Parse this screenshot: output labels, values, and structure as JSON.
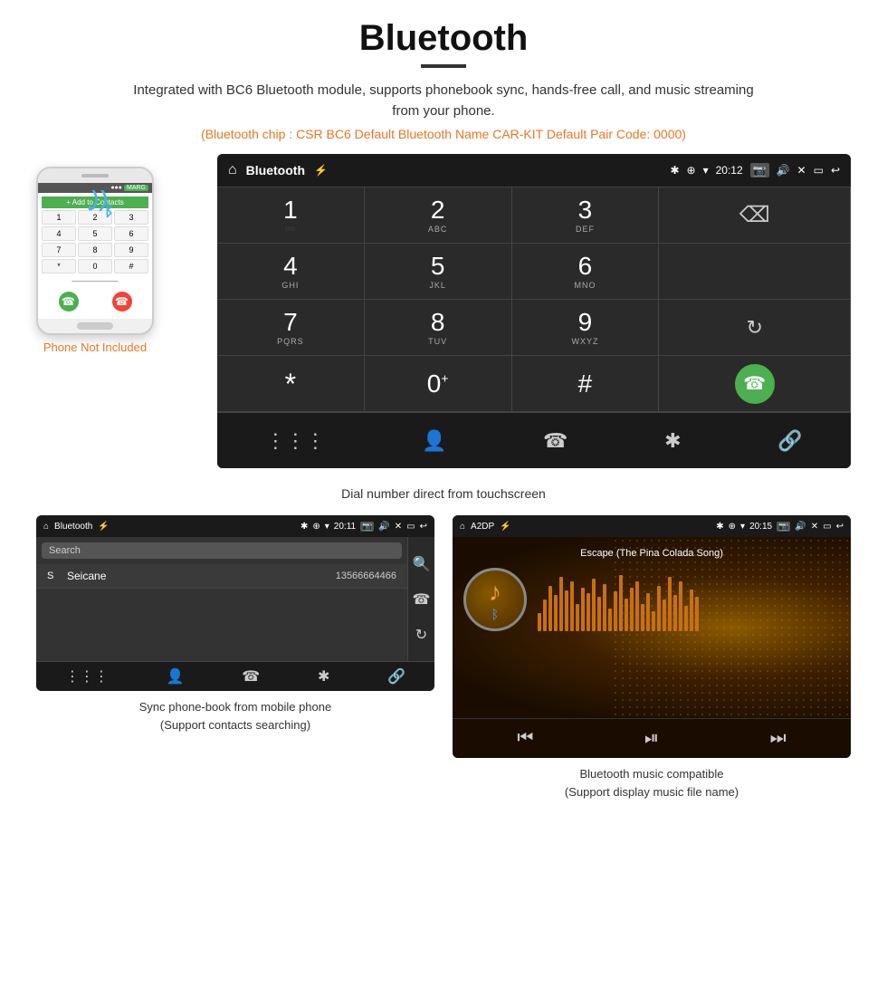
{
  "page": {
    "title": "Bluetooth",
    "subtitle": "Integrated with BC6 Bluetooth module, supports phonebook sync, hands-free call, and music streaming from your phone.",
    "orange_info": "(Bluetooth chip : CSR BC6    Default Bluetooth Name CAR-KIT    Default Pair Code: 0000)",
    "dial_caption": "Dial number direct from touchscreen",
    "phonebook_caption": "Sync phone-book from mobile phone\n(Support contacts searching)",
    "music_caption": "Bluetooth music compatible\n(Support display music file name)"
  },
  "main_screen": {
    "status_bar": {
      "home_icon": "⌂",
      "title": "Bluetooth",
      "usb_icon": "⚡",
      "bt_icon": "✱",
      "location_icon": "◈",
      "signal_icon": "▼",
      "time": "20:12",
      "camera_icon": "📷",
      "volume_icon": "🔊",
      "x_icon": "✕",
      "rect_icon": "▭",
      "back_icon": "↩"
    },
    "dialpad": {
      "keys": [
        {
          "num": "1",
          "sub": "◌◌",
          "col": 0,
          "row": 0
        },
        {
          "num": "2",
          "sub": "ABC",
          "col": 1,
          "row": 0
        },
        {
          "num": "3",
          "sub": "DEF",
          "col": 2,
          "row": 0
        },
        {
          "num": "4",
          "sub": "GHI",
          "col": 0,
          "row": 1
        },
        {
          "num": "5",
          "sub": "JKL",
          "col": 1,
          "row": 1
        },
        {
          "num": "6",
          "sub": "MNO",
          "col": 2,
          "row": 1
        },
        {
          "num": "7",
          "sub": "PQRS",
          "col": 0,
          "row": 2
        },
        {
          "num": "8",
          "sub": "TUV",
          "col": 1,
          "row": 2
        },
        {
          "num": "9",
          "sub": "WXYZ",
          "col": 2,
          "row": 2
        },
        {
          "num": "*",
          "sub": "",
          "col": 0,
          "row": 3
        },
        {
          "num": "0+",
          "sub": "",
          "col": 1,
          "row": 3
        },
        {
          "num": "#",
          "sub": "",
          "col": 2,
          "row": 3
        }
      ]
    },
    "bottom_nav_icons": [
      "⋮⋮⋮",
      "👤",
      "☎",
      "✱",
      "🔗"
    ]
  },
  "phonebook_screen": {
    "status_title": "Bluetooth",
    "time": "20:11",
    "search_placeholder": "Search",
    "contact": {
      "letter": "S",
      "name": "Seicane",
      "number": "13566664466"
    },
    "side_icons": [
      "🔍",
      "☎",
      "↻"
    ],
    "bottom_nav": [
      "⋮⋮⋮",
      "👤",
      "☎",
      "✱",
      "🔗"
    ]
  },
  "music_screen": {
    "status_title": "A2DP",
    "time": "20:15",
    "song_title": "Escape (The Pina Colada Song)",
    "controls": [
      "⏮",
      "⏯",
      "⏭"
    ]
  },
  "phone_graphic": {
    "add_contacts": "+ Add to Contacts",
    "keys": [
      "1",
      "2",
      "3",
      "4",
      "5",
      "6",
      "7",
      "8",
      "9",
      "*",
      "0",
      "#"
    ],
    "not_included": "Phone Not Included"
  }
}
